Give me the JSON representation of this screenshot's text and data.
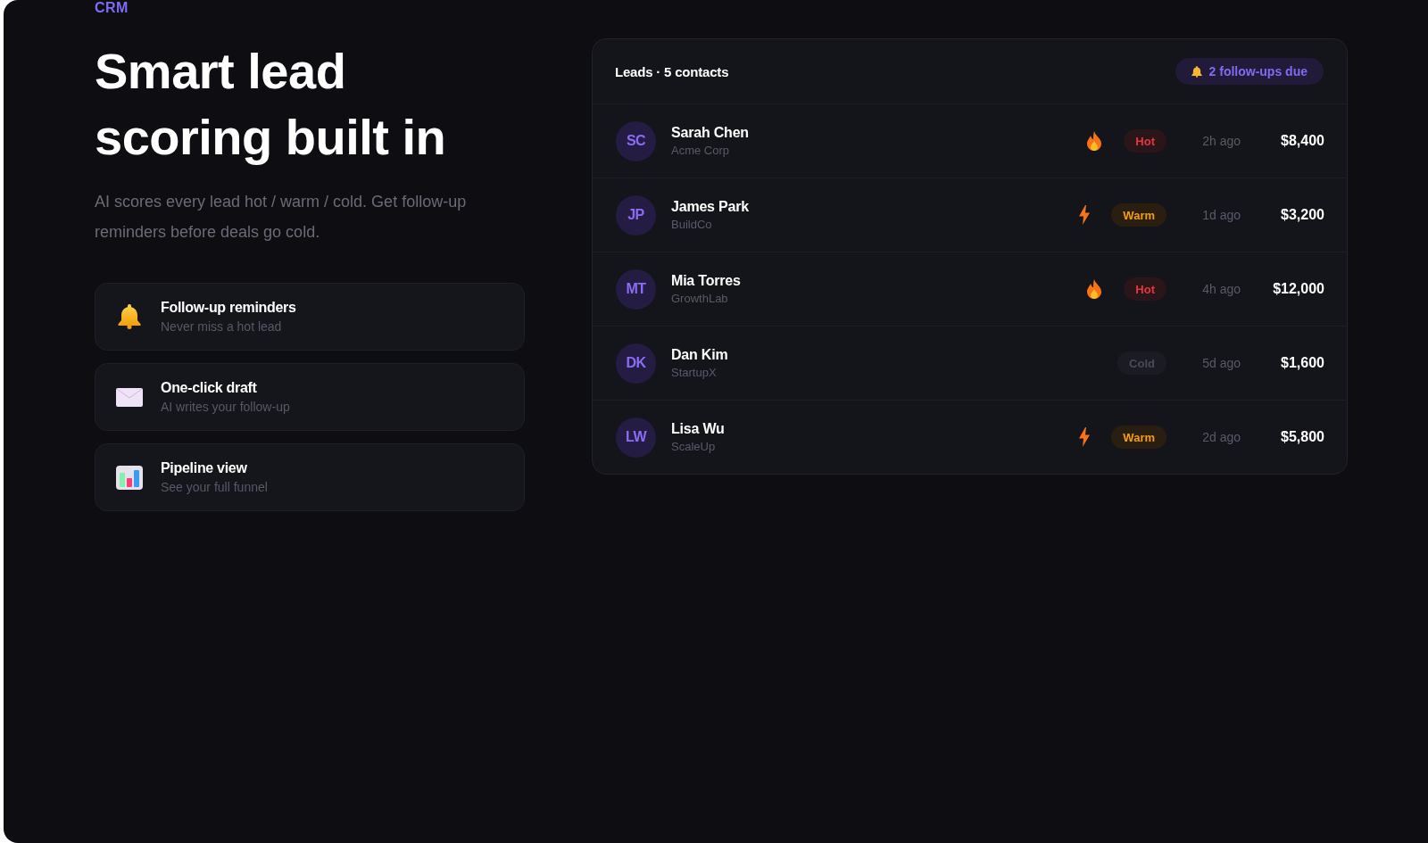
{
  "eyebrow": "CRM",
  "headline": "Smart lead scoring built in",
  "description": "AI scores every lead hot / warm / cold. Get follow-up reminders before deals go cold.",
  "features": [
    {
      "kind": "reminders",
      "title": "Follow-up reminders",
      "subtitle": "Never miss a hot lead"
    },
    {
      "kind": "draft",
      "title": "One-click draft",
      "subtitle": "AI writes your follow-up"
    },
    {
      "kind": "pipeline",
      "title": "Pipeline view",
      "subtitle": "See your full funnel"
    }
  ],
  "leads": {
    "title": "Leads · 5 contacts",
    "badge": "2 follow-ups due",
    "rows": [
      {
        "kind": "hot",
        "initials": "SC",
        "name": "Sarah Chen",
        "company": "Acme Corp",
        "status": "Hot",
        "last_contact": "2h ago",
        "value": "$8,400"
      },
      {
        "kind": "warm",
        "initials": "JP",
        "name": "James Park",
        "company": "BuildCo",
        "status": "Warm",
        "last_contact": "1d ago",
        "value": "$3,200"
      },
      {
        "kind": "hot",
        "initials": "MT",
        "name": "Mia Torres",
        "company": "GrowthLab",
        "status": "Hot",
        "last_contact": "4h ago",
        "value": "$12,000"
      },
      {
        "kind": "cold",
        "initials": "DK",
        "name": "Dan Kim",
        "company": "StartupX",
        "status": "Cold",
        "last_contact": "5d ago",
        "value": "$1,600"
      },
      {
        "kind": "warm",
        "initials": "LW",
        "name": "Lisa Wu",
        "company": "ScaleUp",
        "status": "Warm",
        "last_contact": "2d ago",
        "value": "$5,800"
      }
    ]
  }
}
